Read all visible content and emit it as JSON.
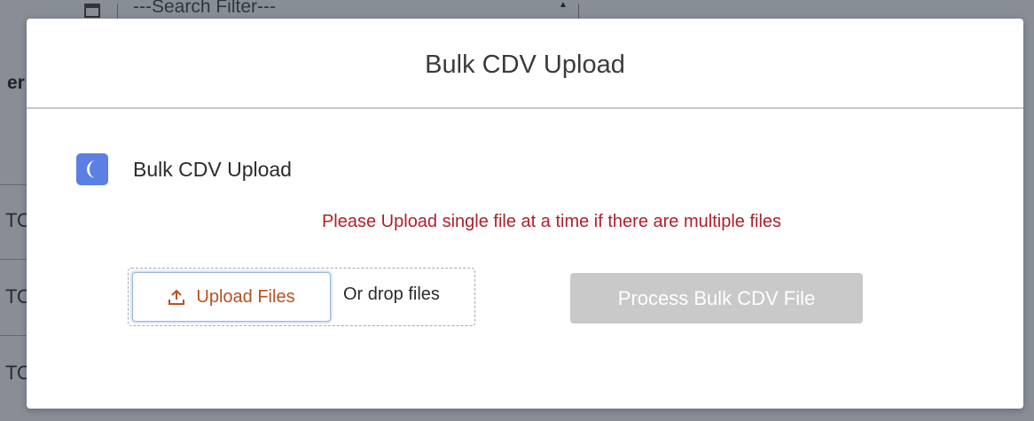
{
  "background": {
    "search_filter_text": "---Search Filter---",
    "column_header_text": "er",
    "row_texts": [
      "TO",
      "TO",
      "TO"
    ]
  },
  "modal": {
    "title": "Bulk CDV Upload",
    "card": {
      "title": "Bulk CDV Upload",
      "icon": "moon-icon",
      "icon_color": "#5b7fe3"
    },
    "notice": "Please Upload single file at a time if there are multiple files",
    "notice_color": "#b0202a",
    "upload": {
      "button_label": "Upload Files",
      "icon": "upload-icon",
      "label_color": "#b8501f",
      "drop_text": "Or drop files"
    },
    "process_button": {
      "label": "Process Bulk CDV File",
      "disabled": true,
      "background": "#c9c9c9"
    }
  }
}
